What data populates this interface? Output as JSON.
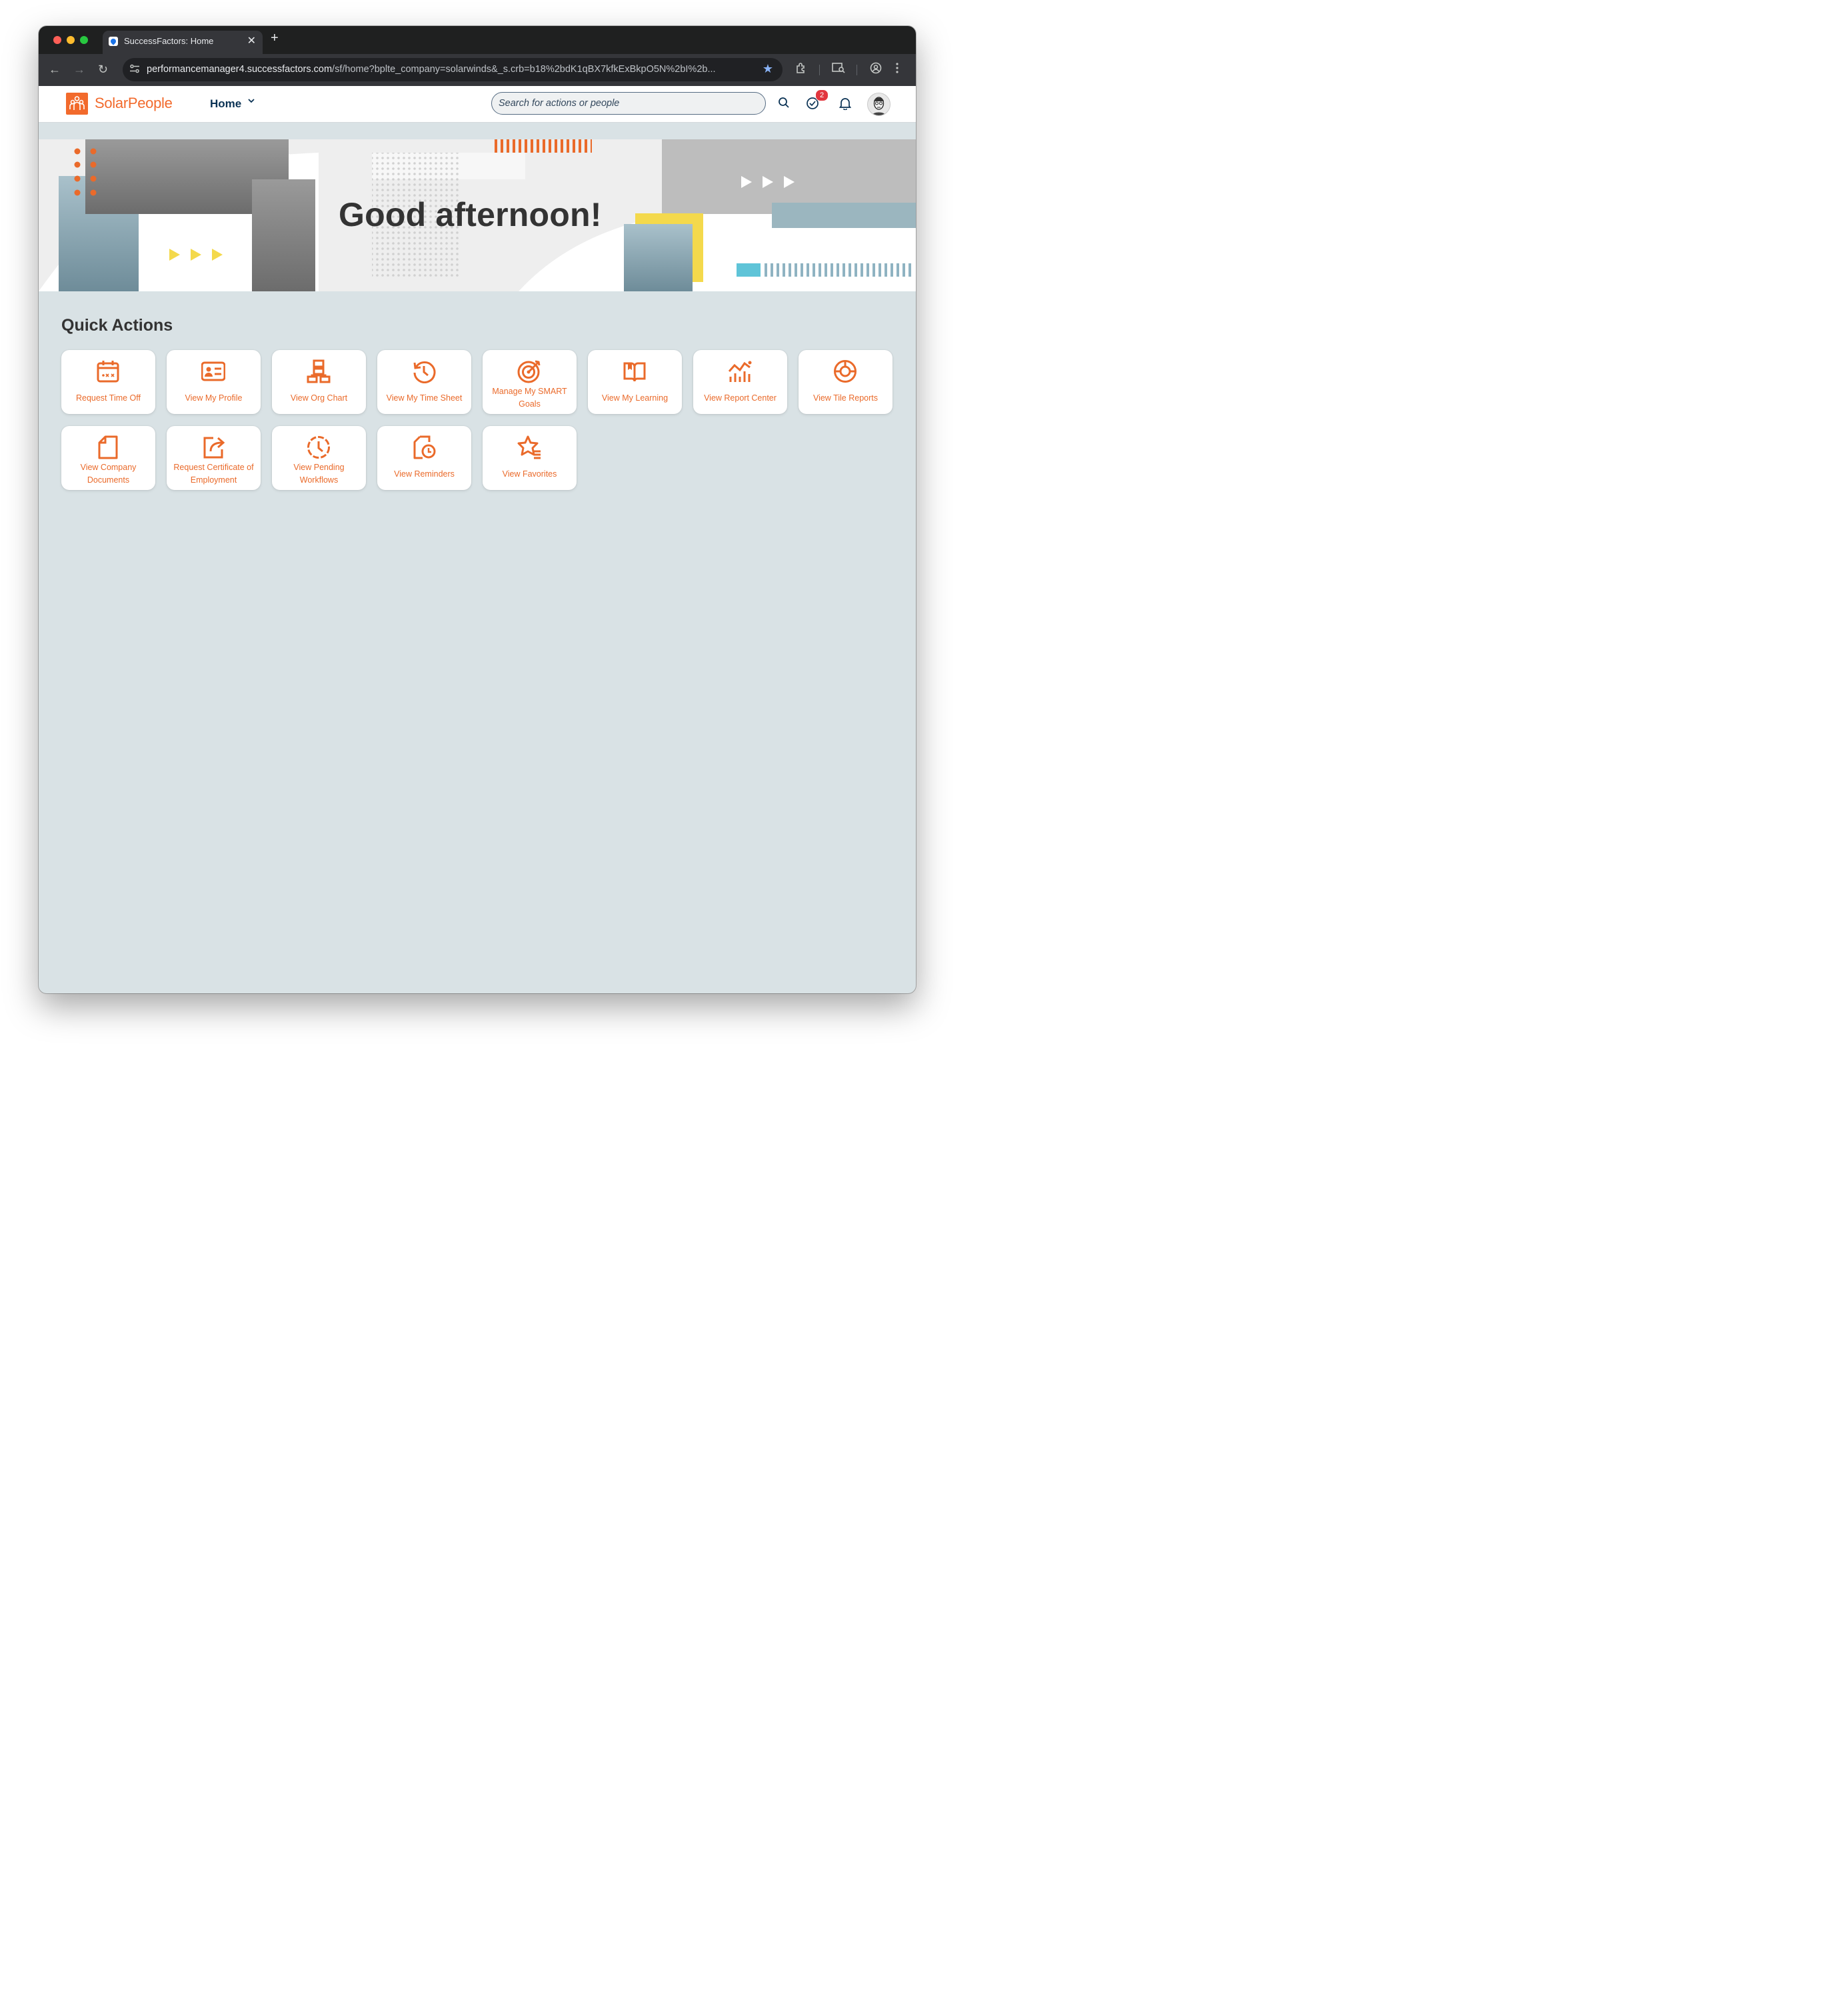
{
  "browser": {
    "tab_title": "SuccessFactors: Home",
    "url_host": "performancemanager4.successfactors.com",
    "url_rest": "/sf/home?bplte_company=solarwinds&_s.crb=b18%2bdK1qBX7kfkExBkpO5N%2bI%2b..."
  },
  "app": {
    "brand": "SolarPeople",
    "nav_label": "Home",
    "search_placeholder": "Search for actions or people",
    "todo_count": "2"
  },
  "banner": {
    "greeting": "Good afternoon!"
  },
  "quick_actions": {
    "title": "Quick Actions",
    "items": [
      {
        "label": "Request Time Off",
        "icon": "calendar-icon"
      },
      {
        "label": "View My Profile",
        "icon": "id-card-icon"
      },
      {
        "label": "View Org Chart",
        "icon": "org-chart-icon"
      },
      {
        "label": "View My Time Sheet",
        "icon": "history-clock-icon"
      },
      {
        "label": "Manage My SMART Goals",
        "icon": "target-icon"
      },
      {
        "label": "View My Learning",
        "icon": "open-book-icon"
      },
      {
        "label": "View Report Center",
        "icon": "line-bar-chart-icon"
      },
      {
        "label": "View Tile Reports",
        "icon": "donut-chart-icon"
      },
      {
        "label": "View Company Documents",
        "icon": "document-icon"
      },
      {
        "label": "Request Certificate of Employment",
        "icon": "share-icon"
      },
      {
        "label": "View Pending Workflows",
        "icon": "pending-clock-icon"
      },
      {
        "label": "View Reminders",
        "icon": "reminder-icon"
      },
      {
        "label": "View Favorites",
        "icon": "favorite-list-icon"
      }
    ]
  },
  "colors": {
    "accent": "#ea6a2a",
    "page_bg": "#d9e2e5",
    "brand": "#f26a2c"
  }
}
